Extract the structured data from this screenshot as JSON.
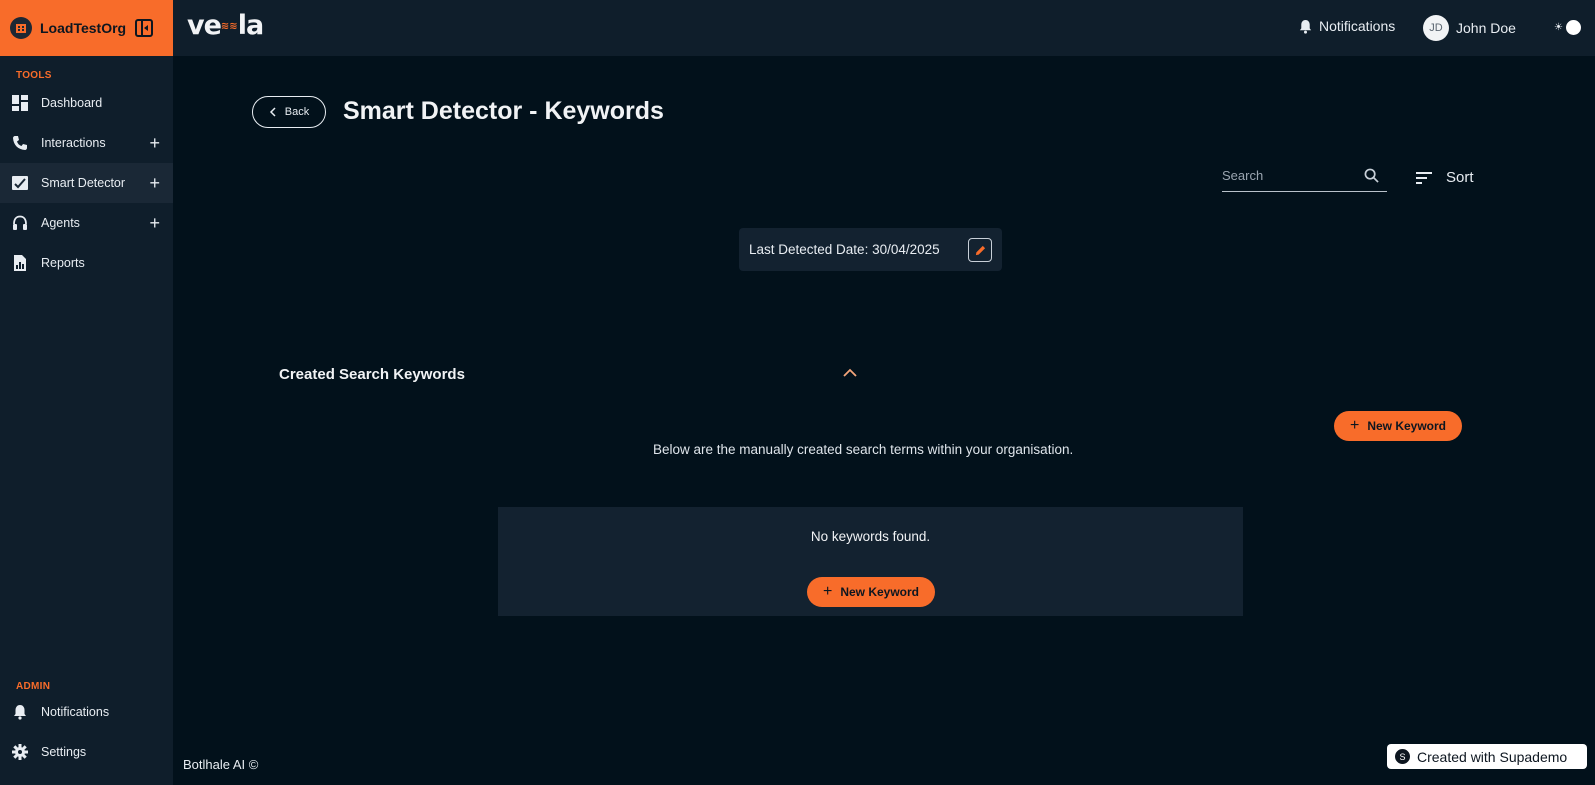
{
  "sidebar": {
    "org_name": "LoadTestOrg",
    "tools_label": "TOOLS",
    "admin_label": "ADMIN",
    "items": [
      {
        "label": "Dashboard"
      },
      {
        "label": "Interactions"
      },
      {
        "label": "Smart Detector"
      },
      {
        "label": "Agents"
      },
      {
        "label": "Reports"
      }
    ],
    "admin_items": [
      {
        "label": "Notifications"
      },
      {
        "label": "Settings"
      }
    ],
    "footer": "Botlhale AI ©"
  },
  "topbar": {
    "logo": "ve  la",
    "notifications_label": "Notifications",
    "user_initials": "JD",
    "user_name": "John Doe"
  },
  "page": {
    "back_label": "Back",
    "title": "Smart Detector - Keywords",
    "search_placeholder": "Search",
    "sort_label": "Sort",
    "last_detected": "Last Detected Date: 30/04/2025",
    "section_title": "Created Search Keywords",
    "new_keyword_label": "New Keyword",
    "description": "Below are the manually created search terms within your organisation.",
    "empty_text": "No keywords found."
  },
  "supademo": {
    "label": "Created with Supademo",
    "icon": "S"
  },
  "colors": {
    "accent": "#f86c2a",
    "sidebar_bg": "#0f1e2b",
    "page_bg": "#02111b",
    "card_bg": "#132230"
  }
}
